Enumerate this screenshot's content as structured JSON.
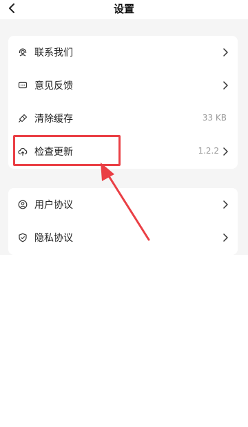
{
  "header": {
    "title": "设置"
  },
  "sections": [
    {
      "items": [
        {
          "label": "联系我们",
          "icon": "headset-icon",
          "value": "",
          "chevron": true
        },
        {
          "label": "意见反馈",
          "icon": "feedback-icon",
          "value": "",
          "chevron": true
        },
        {
          "label": "清除缓存",
          "icon": "clean-icon",
          "value": "33 KB",
          "chevron": false
        },
        {
          "label": "检查更新",
          "icon": "cloud-upload-icon",
          "value": "1.2.2",
          "chevron": true
        }
      ]
    },
    {
      "items": [
        {
          "label": "用户协议",
          "icon": "user-icon",
          "value": "",
          "chevron": true
        },
        {
          "label": "隐私协议",
          "icon": "shield-icon",
          "value": "",
          "chevron": true
        }
      ]
    }
  ],
  "annotation": {
    "highlight_color": "#ea3f45",
    "highlighted_item": "检查更新"
  },
  "colors": {
    "background": "#f5f5f5",
    "card": "#ffffff",
    "text": "#222222",
    "muted": "#9a9a9a"
  }
}
